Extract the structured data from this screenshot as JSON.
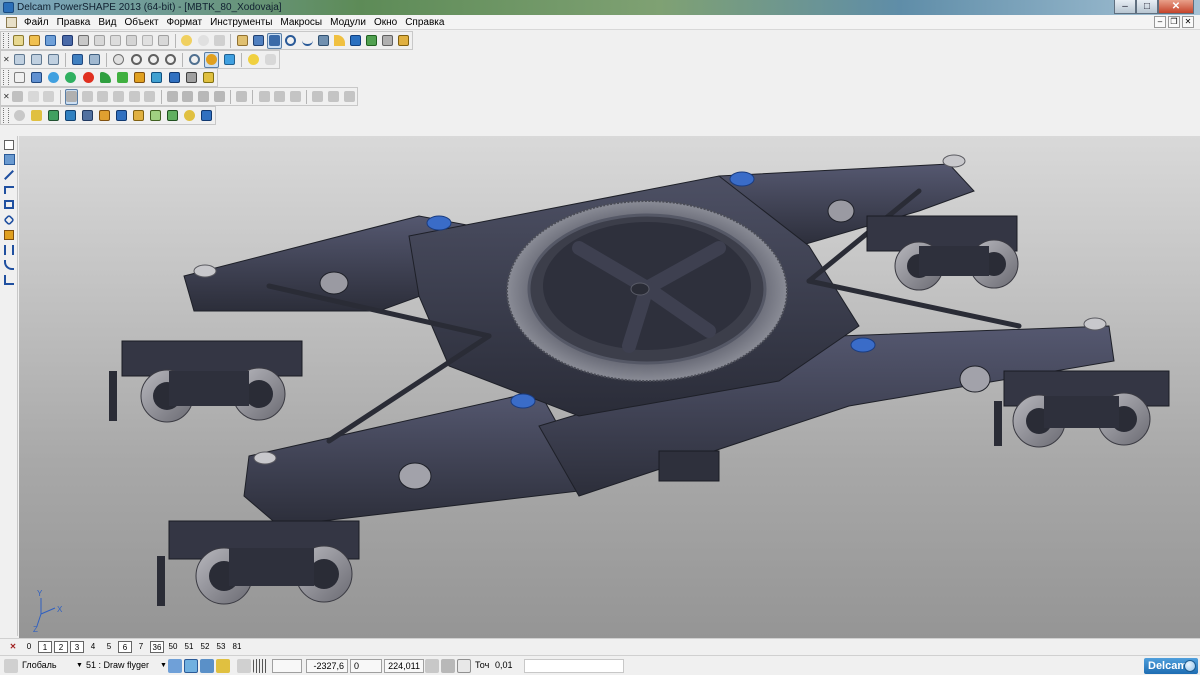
{
  "window": {
    "title": "Delcam PowerSHAPE 2013 (64-bit) - [MBTK_80_Xodovaja]"
  },
  "menu": {
    "items": [
      "Файл",
      "Правка",
      "Вид",
      "Объект",
      "Формат",
      "Инструменты",
      "Макросы",
      "Модули",
      "Окно",
      "Справка"
    ]
  },
  "viewport": {
    "axes": {
      "y": "Y",
      "x": "X",
      "z": "Z"
    }
  },
  "levels": {
    "items": [
      "0",
      "1",
      "2",
      "3",
      "4",
      "5",
      "6",
      "7",
      "36",
      "50",
      "51",
      "52",
      "53",
      "81"
    ]
  },
  "status": {
    "workplane": "Глобаль",
    "level": "51 : Draw flyger",
    "x": "-2327,6",
    "y": "0",
    "z": "224,011",
    "tolerance_label": "Точ",
    "tolerance": "0,01",
    "brand": "Delcam"
  }
}
